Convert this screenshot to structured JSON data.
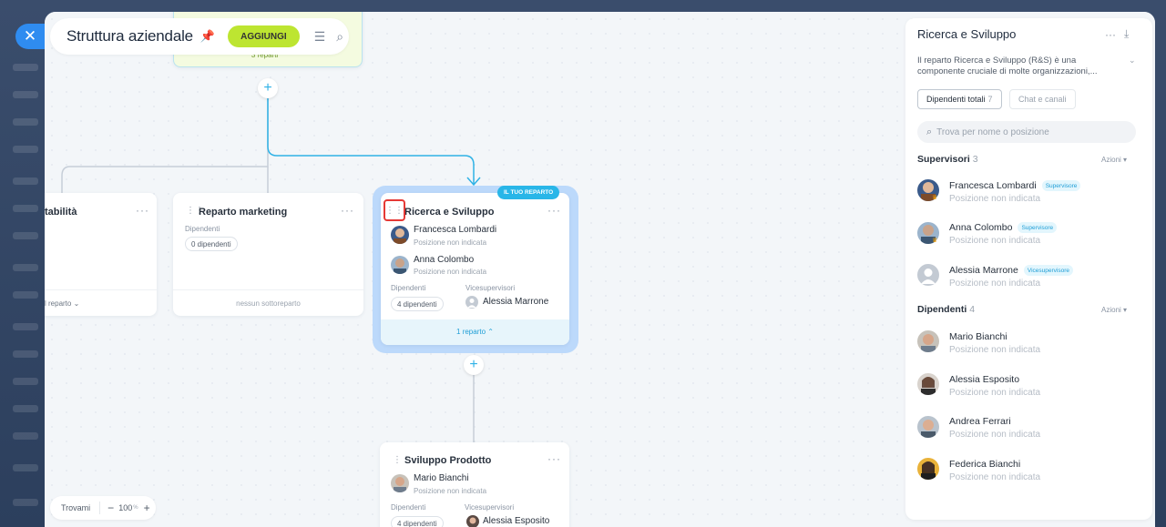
{
  "header": {
    "title": "Struttura aziendale",
    "add_label": "AGGIUNGI"
  },
  "canvas": {
    "top_node_footer": "3 reparti",
    "left_node": {
      "title": "tabilità",
      "footer": "l reparto"
    },
    "marketing_node": {
      "title": "Reparto marketing",
      "label": "Dipendenti",
      "chip": "0 dipendenti",
      "footer": "nessun sottoreparto"
    },
    "rd_node": {
      "badge": "IL TUO REPARTO",
      "title": "Ricerca e Sviluppo",
      "people": [
        {
          "name": "Francesca Lombardi",
          "position": "Posizione non indicata"
        },
        {
          "name": "Anna Colombo",
          "position": "Posizione non indicata"
        }
      ],
      "employees_label": "Dipendenti",
      "employees_chip": "4 dipendenti",
      "vice_label": "Vicesupervisori",
      "vice_name": "Alessia Marrone",
      "footer": "1 reparto"
    },
    "product_node": {
      "title": "Sviluppo Prodotto",
      "person": {
        "name": "Mario Bianchi",
        "position": "Posizione non indicata"
      },
      "employees_label": "Dipendenti",
      "employees_chip": "4 dipendenti",
      "vice_label": "Vicesupervisori",
      "vice_name": "Alessia Esposito"
    }
  },
  "zoom": {
    "find_label": "Trovami",
    "value": "100",
    "unit": "%"
  },
  "panel": {
    "title": "Ricerca e Sviluppo",
    "description": "Il reparto Ricerca e Sviluppo (R&S) è una componente cruciale di molte organizzazioni,...",
    "tabs": [
      {
        "label": "Dipendenti totali",
        "count": "7"
      },
      {
        "label": "Chat e canali"
      }
    ],
    "search_placeholder": "Trova per nome o posizione",
    "supervisors": {
      "title": "Supervisori",
      "count": "3",
      "action": "Azioni",
      "items": [
        {
          "name": "Francesca Lombardi",
          "role": "Supervisore",
          "position": "Posizione non indicata"
        },
        {
          "name": "Anna Colombo",
          "role": "Supervisore",
          "position": "Posizione non indicata"
        },
        {
          "name": "Alessia Marrone",
          "role": "Vicesupervisore",
          "position": "Posizione non indicata"
        }
      ]
    },
    "employees": {
      "title": "Dipendenti",
      "count": "4",
      "action": "Azioni",
      "items": [
        {
          "name": "Mario Bianchi",
          "position": "Posizione non indicata"
        },
        {
          "name": "Alessia Esposito",
          "position": "Posizione non indicata"
        },
        {
          "name": "Andrea Ferrari",
          "position": "Posizione non indicata"
        },
        {
          "name": "Federica Bianchi",
          "position": "Posizione non indicata"
        }
      ]
    }
  }
}
